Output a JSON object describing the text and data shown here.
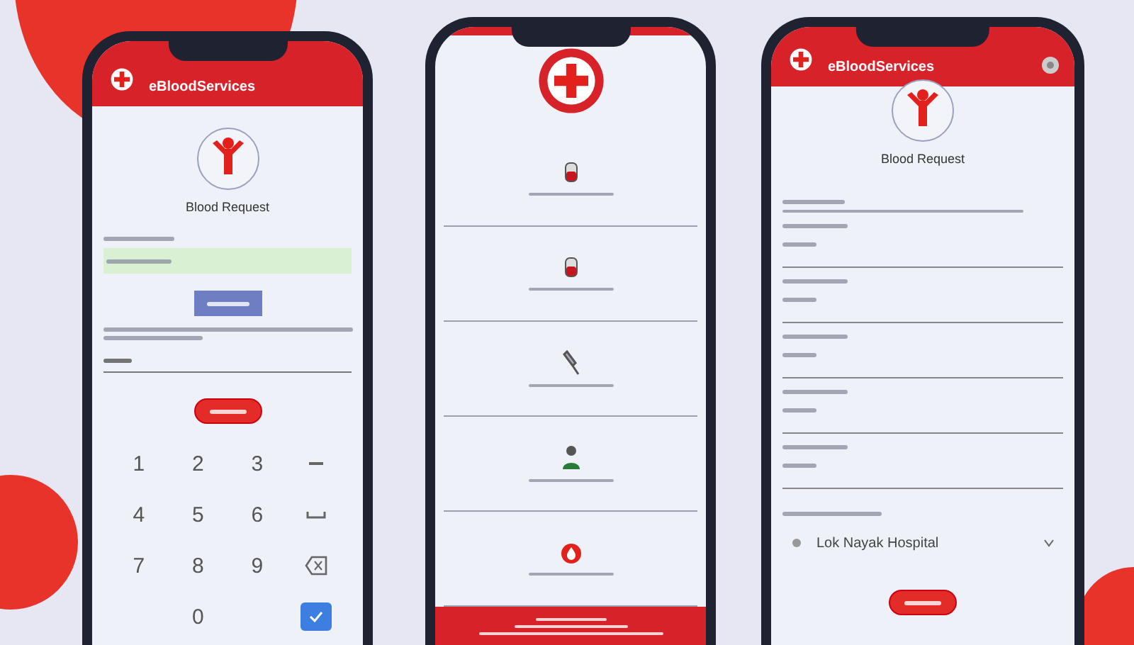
{
  "phones": [
    {
      "kind": "otp",
      "app_title": "eBloodServices",
      "heading": "Blood Request",
      "keypad": [
        {
          "kind": "digit",
          "label": "1"
        },
        {
          "kind": "digit",
          "label": "2"
        },
        {
          "kind": "digit",
          "label": "3"
        },
        {
          "kind": "minus"
        },
        {
          "kind": "digit",
          "label": "4"
        },
        {
          "kind": "digit",
          "label": "5"
        },
        {
          "kind": "digit",
          "label": "6"
        },
        {
          "kind": "space"
        },
        {
          "kind": "digit",
          "label": "7"
        },
        {
          "kind": "digit",
          "label": "8"
        },
        {
          "kind": "digit",
          "label": "9"
        },
        {
          "kind": "backspace"
        },
        {
          "kind": "blank"
        },
        {
          "kind": "digit",
          "label": "0"
        },
        {
          "kind": "blank"
        },
        {
          "kind": "done"
        }
      ]
    },
    {
      "kind": "menu",
      "items": [
        {
          "kind": "bag"
        },
        {
          "kind": "bag"
        },
        {
          "kind": "syringe"
        },
        {
          "kind": "person"
        },
        {
          "kind": "drop"
        }
      ]
    },
    {
      "kind": "form",
      "app_title": "eBloodServices",
      "heading": "Blood Request",
      "fields": [
        {
          "kind": "text"
        },
        {
          "kind": "text"
        },
        {
          "kind": "text"
        },
        {
          "kind": "text"
        },
        {
          "kind": "text"
        }
      ],
      "dropdown": {
        "value": "Lok Nayak Hospital"
      }
    }
  ]
}
